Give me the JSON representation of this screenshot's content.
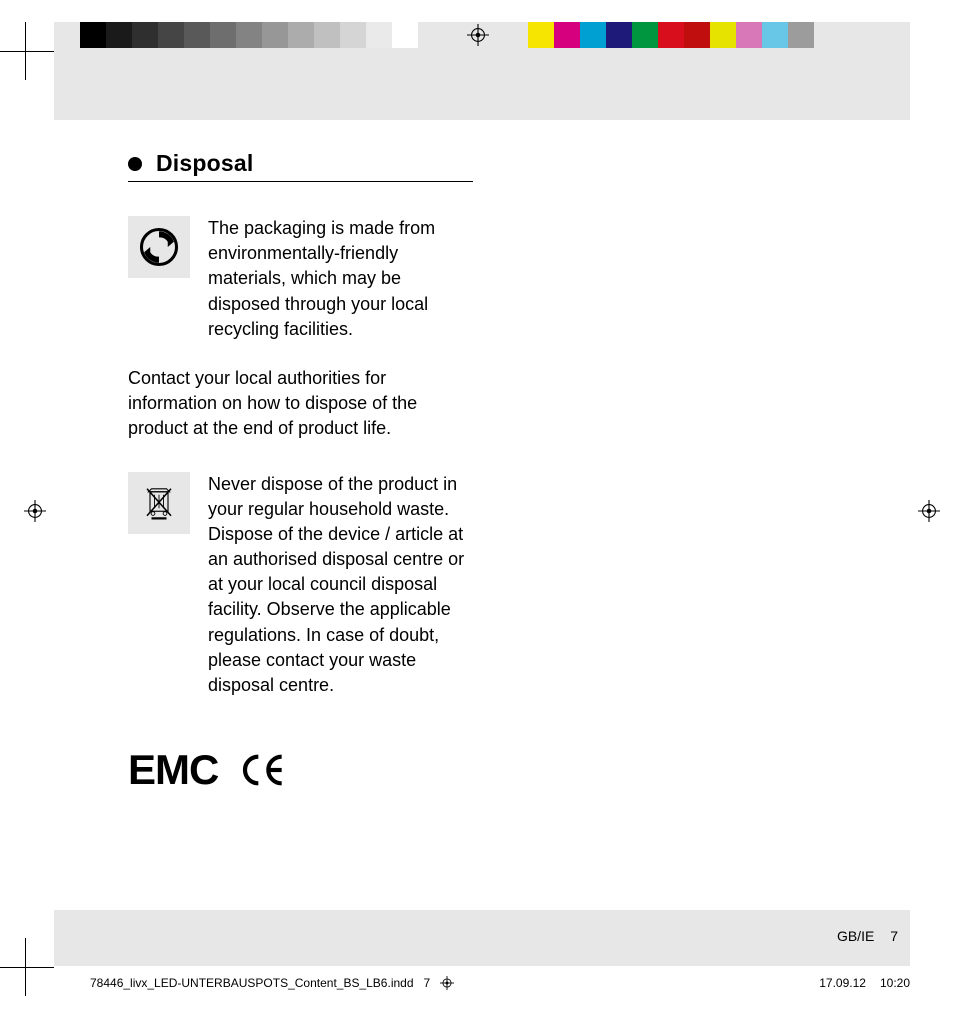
{
  "section": {
    "title": "Disposal",
    "p1": "The packaging is made from environmentally-friendly materials, which may be disposed through your local recycling facilities.",
    "p2": "Contact your local authorities for information on how to dispose of the product at the end of product life.",
    "p3": "Never dispose of the product in your regular household waste. Dispose of the device / article at an authorised disposal centre or at your local council disposal facility. Observe the applicable regulations. In case of doubt, please contact your waste disposal centre."
  },
  "marks": {
    "emc": "EMC"
  },
  "footer": {
    "locale": "GB/IE",
    "page": "7"
  },
  "slug": {
    "file": "78446_livx_LED-UNTERBAUSPOTS_Content_BS_LB6.indd",
    "sheet": "7",
    "date": "17.09.12",
    "time": "10:20"
  },
  "swatches_left": [
    "#000000",
    "#1a1a1a",
    "#2f2f2f",
    "#454545",
    "#595959",
    "#6e6e6e",
    "#838383",
    "#979797",
    "#acacac",
    "#c0c0c0",
    "#d5d5d5",
    "#eaeaea",
    "#ffffff"
  ],
  "swatches_right": [
    "#f6e500",
    "#d6007e",
    "#00a0d2",
    "#1d1a7a",
    "#00963f",
    "#d90e1d",
    "#c00d0d",
    "#e7e300",
    "#d878b9",
    "#68c6e6",
    "#9c9c9c"
  ]
}
